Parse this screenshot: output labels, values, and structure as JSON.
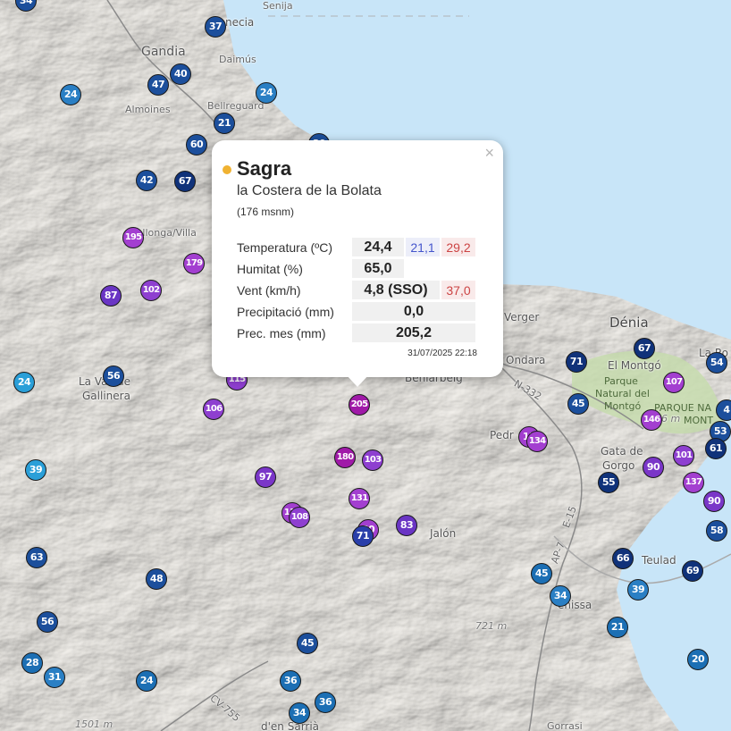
{
  "map": {
    "place_labels": [
      "Gandia",
      "Daimús",
      "Bellreguard",
      "Almoines",
      "Vallonga/Villa",
      "La Vall de",
      "Gallinera",
      "Verger",
      "Dénia",
      "Ondara",
      "El Montgó",
      "Parque",
      "Natural del",
      "Montgó",
      "PARQUE NA",
      "MONT",
      "La Ro",
      "Pedr",
      "Gata de",
      "Gorgo",
      "Jalón",
      "Teulad",
      "enissa",
      "d'en Sarrià",
      "necia",
      "Beniarbeig",
      "N-332",
      "AP-7",
      "E-15",
      "CV-755",
      "Senija",
      "Gorrasi"
    ],
    "elevation_labels": [
      "721 m",
      "1501 m",
      "6 m"
    ],
    "markers": [
      {
        "value": "34",
        "color": "#1c4f9c"
      },
      {
        "value": "37",
        "color": "#1c4f9c"
      },
      {
        "value": "40",
        "color": "#1c4f9c"
      },
      {
        "value": "47",
        "color": "#1c4f9c"
      },
      {
        "value": "24",
        "color": "#2a7fc4"
      },
      {
        "value": "24",
        "color": "#2a7fc4"
      },
      {
        "value": "21",
        "color": "#1c4f9c"
      },
      {
        "value": "60",
        "color": "#1c4f9c"
      },
      {
        "value": "30",
        "color": "#1c4f9c"
      },
      {
        "value": "42",
        "color": "#1c4f9c"
      },
      {
        "value": "67",
        "color": "#10327a"
      },
      {
        "value": "195",
        "color": "#a33fd0"
      },
      {
        "value": "179",
        "color": "#a33fd0"
      },
      {
        "value": "102",
        "color": "#8e3fd0"
      },
      {
        "value": "87",
        "color": "#6a35c4"
      },
      {
        "value": "24",
        "color": "#2a9fd8"
      },
      {
        "value": "56",
        "color": "#1c4f9c"
      },
      {
        "value": "106",
        "color": "#8e3fd0"
      },
      {
        "value": "115",
        "color": "#8e3fd0"
      },
      {
        "value": "205",
        "color": "#a01aa8"
      },
      {
        "value": "180",
        "color": "#a01aa8"
      },
      {
        "value": "103",
        "color": "#8e3fd0"
      },
      {
        "value": "97",
        "color": "#7a36c8"
      },
      {
        "value": "131",
        "color": "#a33fd0"
      },
      {
        "value": "116",
        "color": "#a33fd0"
      },
      {
        "value": "108",
        "color": "#8e3fd0"
      },
      {
        "value": "83",
        "color": "#6a35c4"
      },
      {
        "value": "80",
        "color": "#a33fd0"
      },
      {
        "value": "71",
        "color": "#2a3faa"
      },
      {
        "value": "39",
        "color": "#2a9fd8"
      },
      {
        "value": "63",
        "color": "#1c4f9c"
      },
      {
        "value": "48",
        "color": "#1c4f9c"
      },
      {
        "value": "56",
        "color": "#1c4f9c"
      },
      {
        "value": "28",
        "color": "#1c6fb4"
      },
      {
        "value": "31",
        "color": "#2a7fc4"
      },
      {
        "value": "24",
        "color": "#1c6fb4"
      },
      {
        "value": "45",
        "color": "#1c4f9c"
      },
      {
        "value": "36",
        "color": "#1c6fb4"
      },
      {
        "value": "36",
        "color": "#1c6fb4"
      },
      {
        "value": "34",
        "color": "#1c6fb4"
      },
      {
        "value": "71",
        "color": "#10327a"
      },
      {
        "value": "67",
        "color": "#10327a"
      },
      {
        "value": "45",
        "color": "#1c4f9c"
      },
      {
        "value": "107",
        "color": "#a33fd0"
      },
      {
        "value": "54",
        "color": "#1c4f9c"
      },
      {
        "value": "146",
        "color": "#a33fd0"
      },
      {
        "value": "4",
        "color": "#1c4f9c"
      },
      {
        "value": "53",
        "color": "#1c4f9c"
      },
      {
        "value": "61",
        "color": "#10327a"
      },
      {
        "value": "13",
        "color": "#a33fd0"
      },
      {
        "value": "134",
        "color": "#a33fd0"
      },
      {
        "value": "90",
        "color": "#7a36c8"
      },
      {
        "value": "101",
        "color": "#8e3fd0"
      },
      {
        "value": "137",
        "color": "#a33fd0"
      },
      {
        "value": "90",
        "color": "#7a36c8"
      },
      {
        "value": "55",
        "color": "#10327a"
      },
      {
        "value": "58",
        "color": "#1c4f9c"
      },
      {
        "value": "66",
        "color": "#10327a"
      },
      {
        "value": "69",
        "color": "#10327a"
      },
      {
        "value": "45",
        "color": "#1c6fb4"
      },
      {
        "value": "34",
        "color": "#2a7fc4"
      },
      {
        "value": "39",
        "color": "#2a7fc4"
      },
      {
        "value": "21",
        "color": "#1c6fb4"
      },
      {
        "value": "20",
        "color": "#1c6fb4"
      }
    ]
  },
  "popup": {
    "close_glyph": "×",
    "station_name": "Sagra",
    "region": "la Costera de la Bolata",
    "altitude": "(176 msnm)",
    "status_color": "#f0b232",
    "rows": {
      "temperature": {
        "label": "Temperatura (ºC)",
        "value": "24,4",
        "min": "21,1",
        "max": "29,2"
      },
      "humidity": {
        "label": "Humitat (%)",
        "value": "65,0"
      },
      "wind": {
        "label": "Vent (km/h)",
        "value": "4,8 (SSO)",
        "gust": "37,0"
      },
      "precipitation": {
        "label": "Precipitació (mm)",
        "value": "0,0"
      },
      "month_precipitation": {
        "label": "Prec. mes (mm)",
        "value": "205,2"
      }
    },
    "timestamp": "31/07/2025 22:18"
  }
}
